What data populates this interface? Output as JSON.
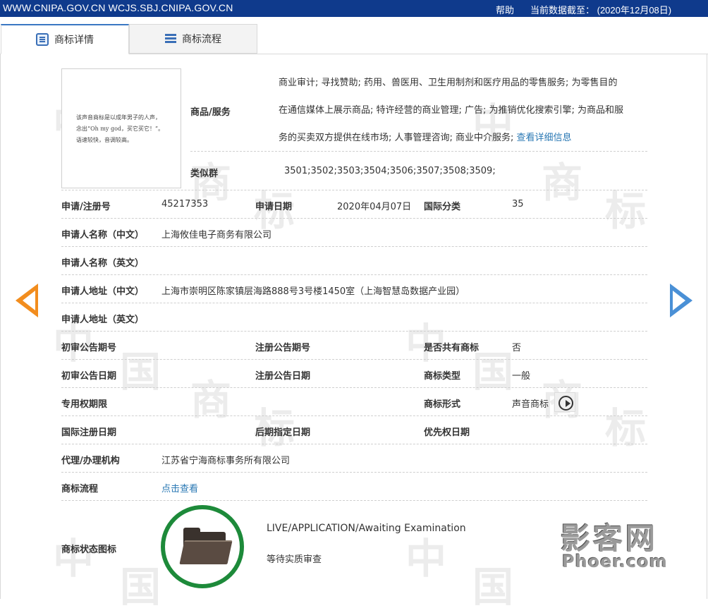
{
  "topbar": {
    "sites": "WWW.CNIPA.GOV.CN WCJS.SBJ.CNIPA.GOV.CN",
    "help": "帮助",
    "data_as_of": "当前数据截至： (2020年12月08日)"
  },
  "tabs": [
    {
      "label": "商标详情",
      "active": true
    },
    {
      "label": "商标流程",
      "active": false
    }
  ],
  "thumbnail": {
    "lines": [
      "该声音商标是以成年男子的人声，",
      "念出“Oh my god，买它买它！”。",
      "语速较快，音调较高。"
    ]
  },
  "goods_services": {
    "label": "商品/服务",
    "lines": [
      "商业审计; 寻找赞助; 药用、兽医用、卫生用制剂和医疗用品的零售服务; 为零售目的",
      "在通信媒体上展示商品; 特许经营的商业管理; 广告; 为推销优化搜索引擎; 为商品和服",
      "务的买卖双方提供在线市场; 人事管理咨询; 商业中介服务;"
    ],
    "detail_link": "查看详细信息"
  },
  "similar_group": {
    "label": "类似群",
    "value": "3501;3502;3503;3504;3506;3507;3508;3509;"
  },
  "fields": {
    "reg_no": {
      "label": "申请/注册号",
      "value": "45217353"
    },
    "apply_date": {
      "label": "申请日期",
      "value": "2020年04月07日"
    },
    "intl_class": {
      "label": "国际分类",
      "value": "35"
    },
    "applicant_cn": {
      "label": "申请人名称（中文）",
      "value": "上海攸佳电子商务有限公司"
    },
    "applicant_en": {
      "label": "申请人名称（英文）",
      "value": ""
    },
    "address_cn": {
      "label": "申请人地址（中文）",
      "value": "上海市崇明区陈家镇层海路888号3号楼1450室（上海智慧岛数据产业园）"
    },
    "address_en": {
      "label": "申请人地址（英文）",
      "value": ""
    },
    "prelim_pub_no": {
      "label": "初审公告期号",
      "value": ""
    },
    "reg_pub_no": {
      "label": "注册公告期号",
      "value": ""
    },
    "shared": {
      "label": "是否共有商标",
      "value": "否"
    },
    "prelim_pub_date": {
      "label": "初审公告日期",
      "value": ""
    },
    "reg_pub_date": {
      "label": "注册公告日期",
      "value": ""
    },
    "tm_type": {
      "label": "商标类型",
      "value": "一般"
    },
    "exclusive_period": {
      "label": "专用权期限",
      "value": ""
    },
    "tm_form": {
      "label": "商标形式",
      "value": "声音商标"
    },
    "intl_reg_date": {
      "label": "国际注册日期",
      "value": ""
    },
    "later_designation": {
      "label": "后期指定日期",
      "value": ""
    },
    "priority_date": {
      "label": "优先权日期",
      "value": ""
    },
    "agent": {
      "label": "代理/办理机构",
      "value": "江苏省宁海商标事务所有限公司"
    },
    "process": {
      "label": "商标流程",
      "value": "点击查看"
    }
  },
  "status": {
    "label": "商标状态图标",
    "status_en": "LIVE/APPLICATION/Awaiting Examination",
    "status_cn": "等待实质审查"
  },
  "watermark": {
    "chars": [
      "中",
      "国",
      "商",
      "标"
    ],
    "logo_line1": "影客网",
    "logo_line2": "Phoer.com"
  },
  "colors": {
    "topbar": "#0f3a8c",
    "link": "#2a78b4",
    "status_ring": "#1d8a3a",
    "arrow_left": "#f28d1e",
    "arrow_right": "#4a90d6"
  }
}
